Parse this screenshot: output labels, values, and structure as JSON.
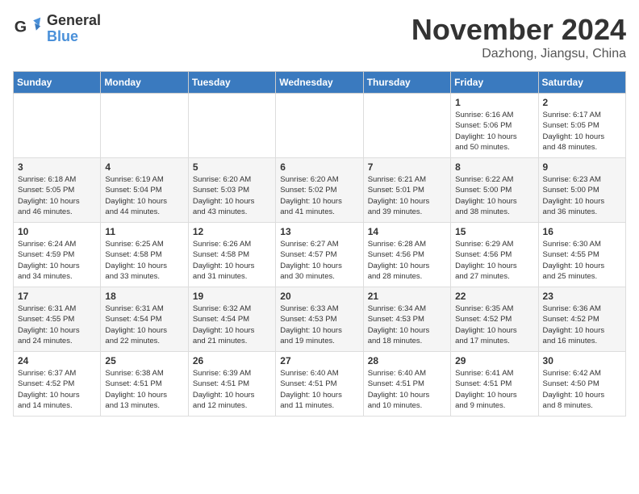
{
  "logo": {
    "general": "General",
    "blue": "Blue"
  },
  "title": {
    "month": "November 2024",
    "location": "Dazhong, Jiangsu, China"
  },
  "headers": [
    "Sunday",
    "Monday",
    "Tuesday",
    "Wednesday",
    "Thursday",
    "Friday",
    "Saturday"
  ],
  "weeks": [
    [
      {
        "day": "",
        "info": ""
      },
      {
        "day": "",
        "info": ""
      },
      {
        "day": "",
        "info": ""
      },
      {
        "day": "",
        "info": ""
      },
      {
        "day": "",
        "info": ""
      },
      {
        "day": "1",
        "info": "Sunrise: 6:16 AM\nSunset: 5:06 PM\nDaylight: 10 hours\nand 50 minutes."
      },
      {
        "day": "2",
        "info": "Sunrise: 6:17 AM\nSunset: 5:05 PM\nDaylight: 10 hours\nand 48 minutes."
      }
    ],
    [
      {
        "day": "3",
        "info": "Sunrise: 6:18 AM\nSunset: 5:05 PM\nDaylight: 10 hours\nand 46 minutes."
      },
      {
        "day": "4",
        "info": "Sunrise: 6:19 AM\nSunset: 5:04 PM\nDaylight: 10 hours\nand 44 minutes."
      },
      {
        "day": "5",
        "info": "Sunrise: 6:20 AM\nSunset: 5:03 PM\nDaylight: 10 hours\nand 43 minutes."
      },
      {
        "day": "6",
        "info": "Sunrise: 6:20 AM\nSunset: 5:02 PM\nDaylight: 10 hours\nand 41 minutes."
      },
      {
        "day": "7",
        "info": "Sunrise: 6:21 AM\nSunset: 5:01 PM\nDaylight: 10 hours\nand 39 minutes."
      },
      {
        "day": "8",
        "info": "Sunrise: 6:22 AM\nSunset: 5:00 PM\nDaylight: 10 hours\nand 38 minutes."
      },
      {
        "day": "9",
        "info": "Sunrise: 6:23 AM\nSunset: 5:00 PM\nDaylight: 10 hours\nand 36 minutes."
      }
    ],
    [
      {
        "day": "10",
        "info": "Sunrise: 6:24 AM\nSunset: 4:59 PM\nDaylight: 10 hours\nand 34 minutes."
      },
      {
        "day": "11",
        "info": "Sunrise: 6:25 AM\nSunset: 4:58 PM\nDaylight: 10 hours\nand 33 minutes."
      },
      {
        "day": "12",
        "info": "Sunrise: 6:26 AM\nSunset: 4:58 PM\nDaylight: 10 hours\nand 31 minutes."
      },
      {
        "day": "13",
        "info": "Sunrise: 6:27 AM\nSunset: 4:57 PM\nDaylight: 10 hours\nand 30 minutes."
      },
      {
        "day": "14",
        "info": "Sunrise: 6:28 AM\nSunset: 4:56 PM\nDaylight: 10 hours\nand 28 minutes."
      },
      {
        "day": "15",
        "info": "Sunrise: 6:29 AM\nSunset: 4:56 PM\nDaylight: 10 hours\nand 27 minutes."
      },
      {
        "day": "16",
        "info": "Sunrise: 6:30 AM\nSunset: 4:55 PM\nDaylight: 10 hours\nand 25 minutes."
      }
    ],
    [
      {
        "day": "17",
        "info": "Sunrise: 6:31 AM\nSunset: 4:55 PM\nDaylight: 10 hours\nand 24 minutes."
      },
      {
        "day": "18",
        "info": "Sunrise: 6:31 AM\nSunset: 4:54 PM\nDaylight: 10 hours\nand 22 minutes."
      },
      {
        "day": "19",
        "info": "Sunrise: 6:32 AM\nSunset: 4:54 PM\nDaylight: 10 hours\nand 21 minutes."
      },
      {
        "day": "20",
        "info": "Sunrise: 6:33 AM\nSunset: 4:53 PM\nDaylight: 10 hours\nand 19 minutes."
      },
      {
        "day": "21",
        "info": "Sunrise: 6:34 AM\nSunset: 4:53 PM\nDaylight: 10 hours\nand 18 minutes."
      },
      {
        "day": "22",
        "info": "Sunrise: 6:35 AM\nSunset: 4:52 PM\nDaylight: 10 hours\nand 17 minutes."
      },
      {
        "day": "23",
        "info": "Sunrise: 6:36 AM\nSunset: 4:52 PM\nDaylight: 10 hours\nand 16 minutes."
      }
    ],
    [
      {
        "day": "24",
        "info": "Sunrise: 6:37 AM\nSunset: 4:52 PM\nDaylight: 10 hours\nand 14 minutes."
      },
      {
        "day": "25",
        "info": "Sunrise: 6:38 AM\nSunset: 4:51 PM\nDaylight: 10 hours\nand 13 minutes."
      },
      {
        "day": "26",
        "info": "Sunrise: 6:39 AM\nSunset: 4:51 PM\nDaylight: 10 hours\nand 12 minutes."
      },
      {
        "day": "27",
        "info": "Sunrise: 6:40 AM\nSunset: 4:51 PM\nDaylight: 10 hours\nand 11 minutes."
      },
      {
        "day": "28",
        "info": "Sunrise: 6:40 AM\nSunset: 4:51 PM\nDaylight: 10 hours\nand 10 minutes."
      },
      {
        "day": "29",
        "info": "Sunrise: 6:41 AM\nSunset: 4:51 PM\nDaylight: 10 hours\nand 9 minutes."
      },
      {
        "day": "30",
        "info": "Sunrise: 6:42 AM\nSunset: 4:50 PM\nDaylight: 10 hours\nand 8 minutes."
      }
    ]
  ]
}
